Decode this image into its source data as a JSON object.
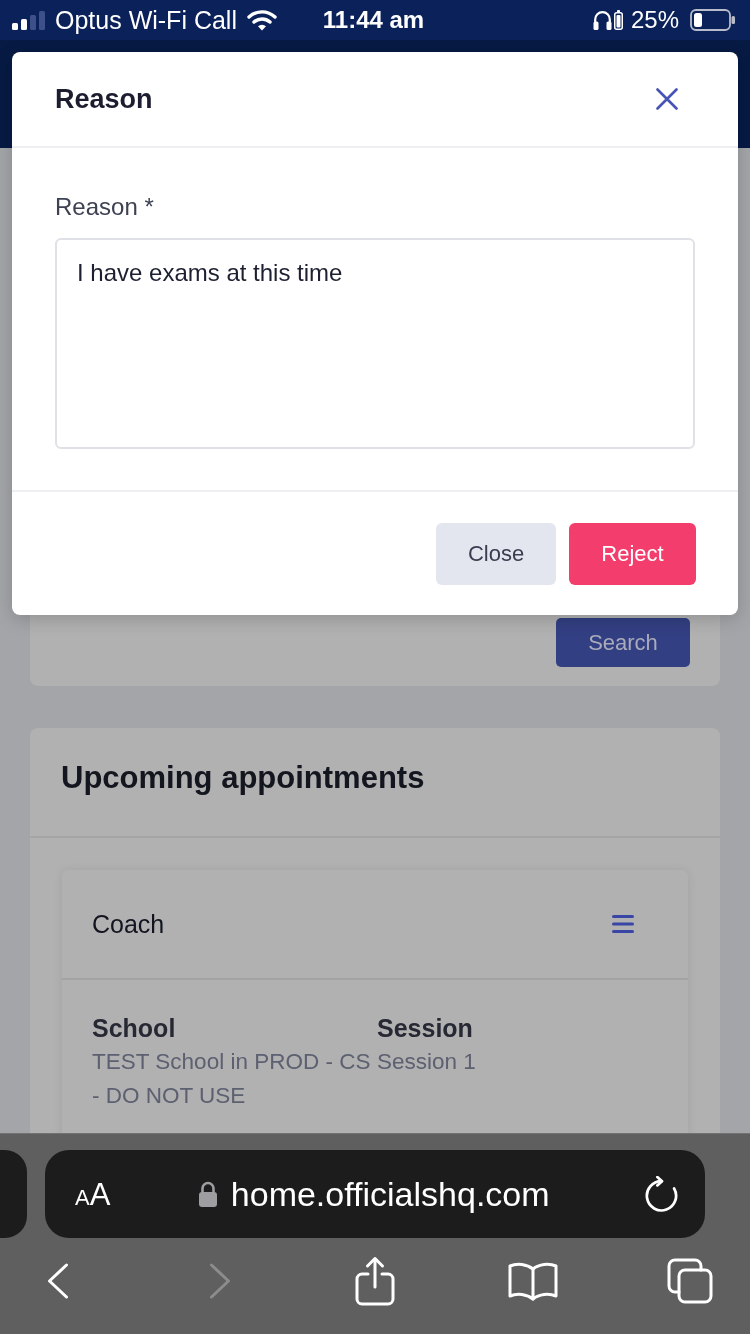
{
  "status_bar": {
    "carrier": "Optus Wi-Fi Call",
    "time": "11:44 am",
    "battery": "25%"
  },
  "modal": {
    "title": "Reason",
    "field": {
      "label": "Reason *",
      "value": "I have exams at this time"
    },
    "buttons": [
      {
        "label": "Close",
        "kind": "secondary"
      },
      {
        "label": "Reject",
        "kind": "danger"
      }
    ]
  },
  "search_card": {
    "button": "Search"
  },
  "appointments": {
    "title": "Upcoming appointments",
    "cards": [
      {
        "title": "Coach",
        "fields": [
          {
            "label": "School",
            "value": "TEST School in PROD - CS - DO NOT USE"
          },
          {
            "label": "Session",
            "value": "Session 1"
          }
        ]
      }
    ]
  },
  "browser": {
    "page_settings": "AA",
    "url": "home.officialshq.com",
    "nav": [
      {
        "kind": "back",
        "disabled": false
      },
      {
        "kind": "forward",
        "disabled": true
      },
      {
        "kind": "share",
        "disabled": false
      },
      {
        "kind": "bookmarks",
        "disabled": false
      },
      {
        "kind": "tabs",
        "disabled": false
      }
    ]
  }
}
